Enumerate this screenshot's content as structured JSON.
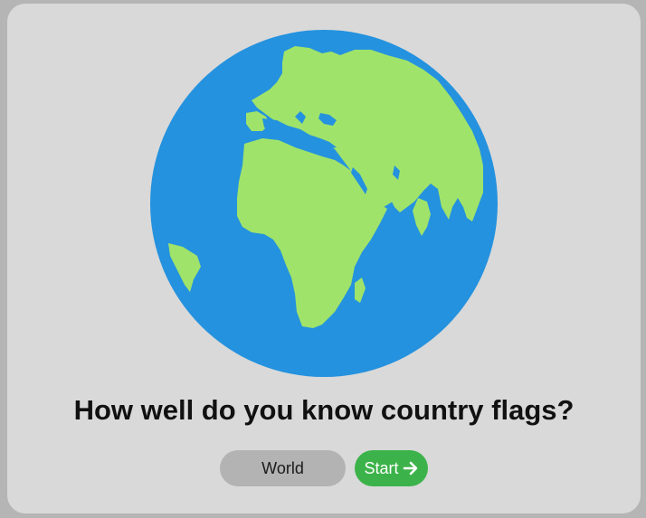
{
  "hero": {
    "icon": "globe-icon",
    "ocean_color": "#2492de",
    "land_color": "#a0e36a"
  },
  "quiz": {
    "question": "How well do you know country flags?"
  },
  "controls": {
    "region_label": "World",
    "start_label": "Start",
    "start_icon": "arrow-right-icon",
    "start_color": "#3cb34a",
    "region_color": "#b3b3b3"
  }
}
